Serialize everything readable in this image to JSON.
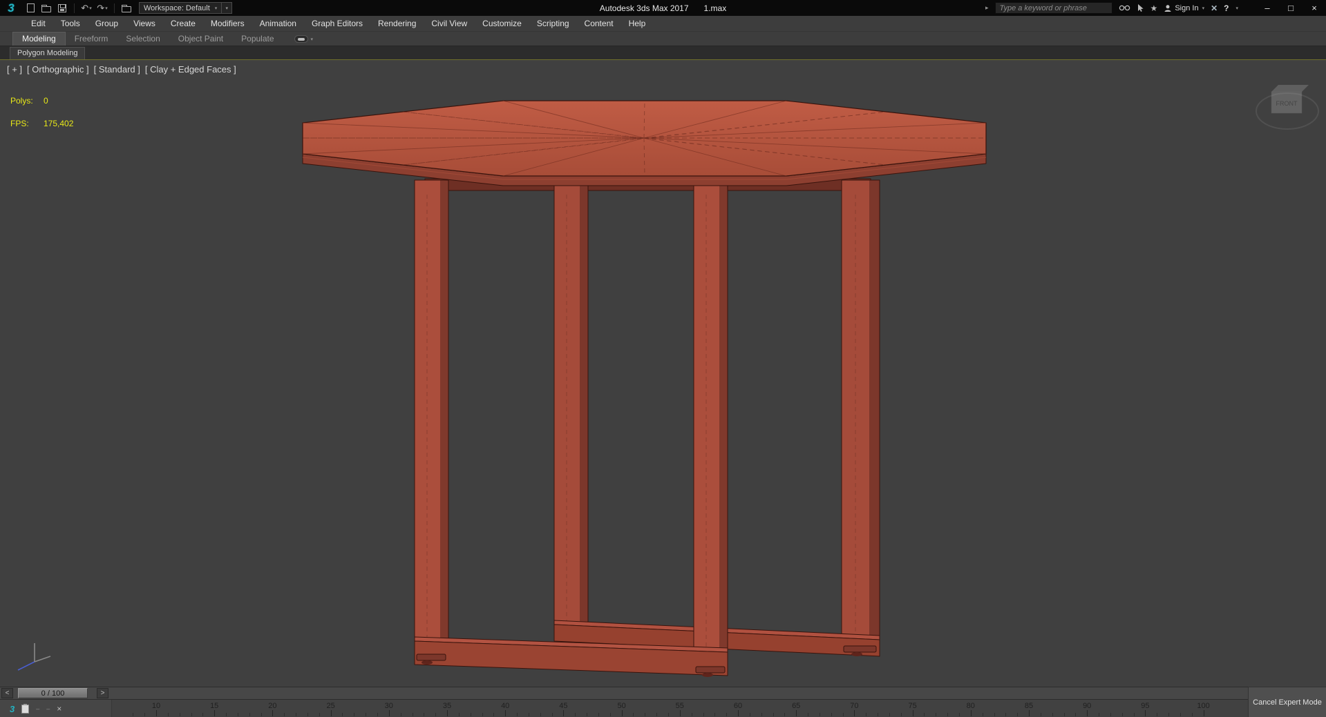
{
  "colors": {
    "clay": "#b2543e",
    "clay_dark": "#8d3f30",
    "edge": "#38130c",
    "stats_yellow": "#e9e917",
    "viewport_bg": "#404040",
    "logo_teal": "#23b3c3",
    "active_viewport_border": "#70702c"
  },
  "titlebar": {
    "app_name": "Autodesk 3ds Max 2017",
    "file_name": "1.max",
    "workspace_label": "Workspace: Default",
    "workspace_caret": "▾",
    "undo_glyph": "↶",
    "redo_glyph": "↷",
    "search_expand_glyph": "▸",
    "search_placeholder": "Type a keyword or phrase",
    "favorites_star_glyph": "★",
    "sign_in_label": "Sign In",
    "sign_in_caret": "▾",
    "communication_glyph": "✕",
    "help_glyph": "?",
    "help_caret": "▾",
    "minimize_glyph": "–",
    "maximize_glyph": "□",
    "close_glyph": "×"
  },
  "menubar": {
    "items": [
      "Edit",
      "Tools",
      "Group",
      "Views",
      "Create",
      "Modifiers",
      "Animation",
      "Graph Editors",
      "Rendering",
      "Civil View",
      "Customize",
      "Scripting",
      "Content",
      "Help"
    ]
  },
  "ribbon": {
    "tabs": [
      {
        "label": "Modeling",
        "active": true
      },
      {
        "label": "Freeform",
        "active": false
      },
      {
        "label": "Selection",
        "active": false
      },
      {
        "label": "Object Paint",
        "active": false
      },
      {
        "label": "Populate",
        "active": false
      }
    ],
    "overflow_caret": "▾",
    "panel_label": "Polygon Modeling"
  },
  "viewport": {
    "label_plus": "[ + ]",
    "label_view": "[ Orthographic ]",
    "label_standard": "[ Standard ]",
    "label_shading": "[ Clay + Edged Faces ]",
    "stats": {
      "polys_label": "Polys:",
      "polys_value": "0",
      "fps_label": "FPS:",
      "fps_value": "175,402"
    },
    "viewcube_label": "FRONT"
  },
  "timeline": {
    "prev": "<",
    "next": ">",
    "slider_value": "0 / 100",
    "tick_labels": [
      "10",
      "15",
      "20",
      "25",
      "30",
      "35",
      "40",
      "45",
      "50",
      "55",
      "60",
      "65",
      "70",
      "75",
      "80",
      "85",
      "90",
      "95",
      "100"
    ]
  },
  "statusbar": {
    "cancel_expert_mode": "Cancel Expert Mode",
    "trackbar_close_glyph": "×",
    "mini_dash_glyph": "–"
  }
}
